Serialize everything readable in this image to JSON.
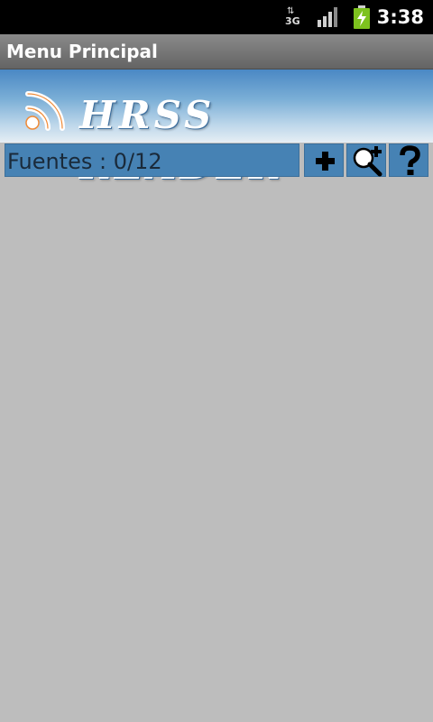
{
  "status_bar": {
    "network_type": "3G",
    "data_arrows": "⇅",
    "time": "3:38",
    "signal_icon": "signal-bars-icon",
    "battery_icon": "battery-charging-icon"
  },
  "window": {
    "title": "Menu Principal"
  },
  "banner": {
    "app_name": "HRSS READER",
    "logo_icon": "rss-feed-icon"
  },
  "toolbar": {
    "sources_counter": "Fuentes : 0/12",
    "add_icon": "plus-icon",
    "search_icon": "zoom-in-icon",
    "help_icon": "question-mark-icon"
  },
  "colors": {
    "status_bar": "#000000",
    "title_bar": "#7a7a7a",
    "accent_blue": "#4682b4",
    "background": "#bdbdbd",
    "battery_green": "#7dc21e"
  }
}
